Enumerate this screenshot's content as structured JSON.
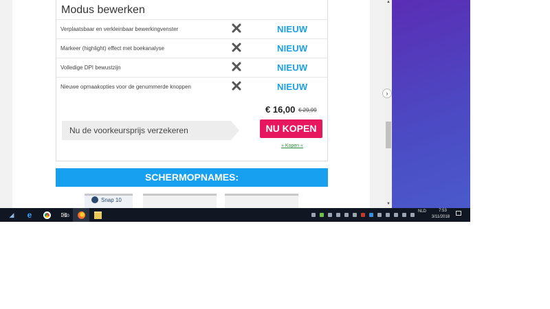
{
  "card": {
    "title": "Modus bewerken",
    "features": [
      {
        "label": "Verplaatsbaar en verkleinbaar bewerkingvenster",
        "badge": "NIEUW"
      },
      {
        "label": "Markeer (highlight) effect met boekanalyse",
        "badge": "NIEUW"
      },
      {
        "label": "Volledige DPI bewustzijn",
        "badge": "NIEUW"
      },
      {
        "label": "Nieuwe opmaakopties voor de genummerde knoppen",
        "badge": "NIEUW"
      }
    ],
    "price": "€ 16,00",
    "old_price": "€ 29,99",
    "cta_text": "Nu de voorkeursprijs verzekeren",
    "buy_button": "NU KOPEN",
    "buy_link": "» Kopen «"
  },
  "screenshots": {
    "header": "SCHERMOPNAMES:",
    "thumb_1_text": "Snap 10"
  },
  "taskbar": {
    "mail_badge": "10",
    "language": "NLD",
    "time": "7:53",
    "date": "3/11/2018"
  },
  "colors": {
    "accent_blue": "#18a0f0",
    "buy_red": "#e6175e",
    "nieuw_blue": "#1aa0e6",
    "side_panel": "#5031bb",
    "taskbar": "#101622"
  },
  "icons": [
    "close-x-icon",
    "chevron-right-icon",
    "windows-start-icon",
    "edge-icon",
    "chrome-icon",
    "mail-icon",
    "firefox-icon",
    "file-explorer-icon",
    "notification-icon"
  ]
}
